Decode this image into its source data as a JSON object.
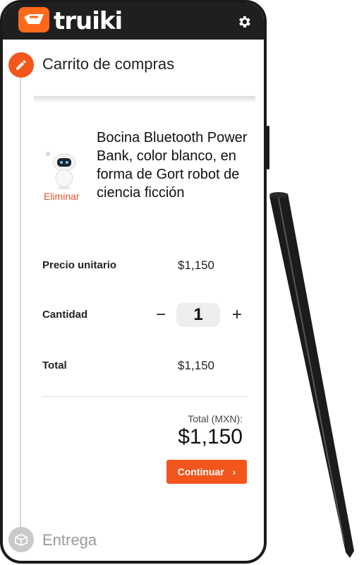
{
  "header": {
    "logo_text": "truiki",
    "settings_icon": "gear-icon"
  },
  "steps": {
    "cart_title": "Carrito de compras",
    "delivery_title": "Entrega"
  },
  "product": {
    "name": "Bocina Bluetooth Power Bank, color blanco, en forma de Gort robot de ciencia ficción",
    "remove_label": "Eliminar"
  },
  "rows": {
    "unit_price_label": "Precio unitario",
    "unit_price_value": "$1,150",
    "quantity_label": "Cantidad",
    "quantity_value": "1",
    "total_label": "Total",
    "total_value": "$1,150"
  },
  "summary": {
    "caption": "Total (MXN):",
    "amount": "$1,150",
    "continue_label": "Continuar"
  },
  "colors": {
    "accent": "#f2561d",
    "header": "#1f1f1f"
  }
}
